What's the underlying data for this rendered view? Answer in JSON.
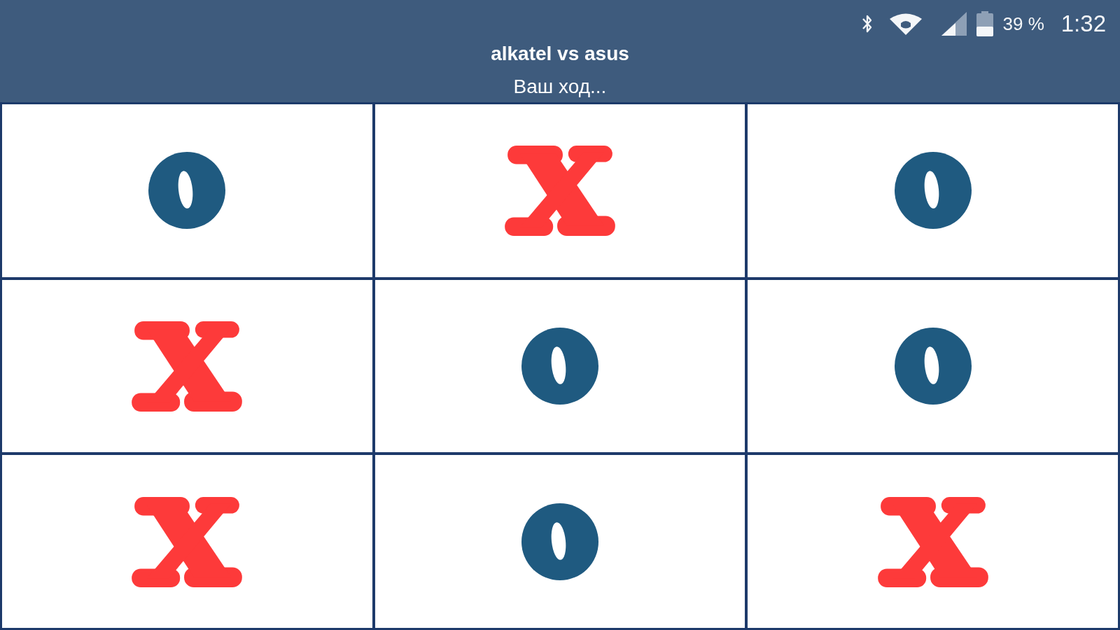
{
  "status_bar": {
    "battery": "39 %",
    "time": "1:32"
  },
  "header": {
    "title": "alkatel vs asus",
    "subtitle": "Ваш ход..."
  },
  "board": [
    {
      "kind": "o"
    },
    {
      "kind": "x"
    },
    {
      "kind": "o"
    },
    {
      "kind": "x"
    },
    {
      "kind": "o"
    },
    {
      "kind": "o"
    },
    {
      "kind": "x"
    },
    {
      "kind": "o"
    },
    {
      "kind": "x"
    }
  ]
}
